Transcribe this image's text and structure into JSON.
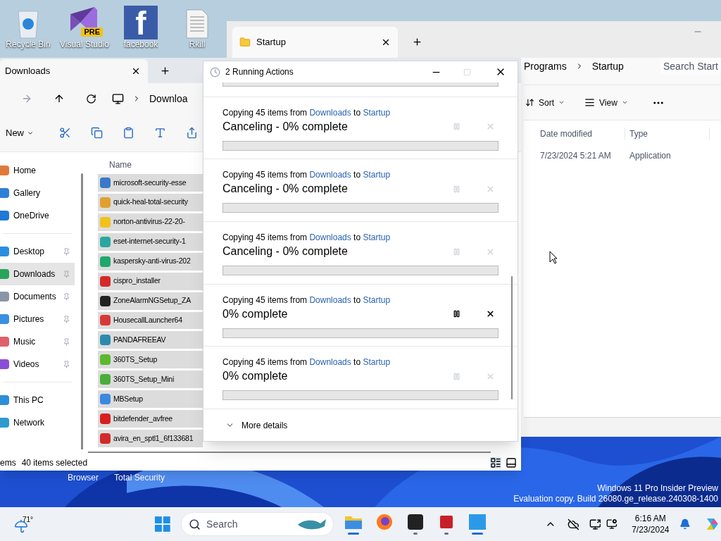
{
  "desktop": {
    "icons": [
      {
        "kind": "bin",
        "label": "Recycle Bin"
      },
      {
        "kind": "vs",
        "label": "Visual Studio",
        "badge": "PRE"
      },
      {
        "kind": "fb",
        "label": "facebook",
        "glyph": "f"
      },
      {
        "kind": "doc",
        "label": "Rkill"
      }
    ],
    "hidden_labels": [
      "Browser",
      "Total Security"
    ],
    "watermark": [
      "Windows 11 Pro Insider Preview",
      "Evaluation copy. Build 26080.ge_release.240308-1400"
    ]
  },
  "startup_window": {
    "tab": "Startup",
    "breadcrumb": [
      "Programs",
      "Startup"
    ],
    "search": {
      "placeholder": "Search Start"
    },
    "toolbar": [
      "Sort",
      "View"
    ],
    "columns": [
      "Date modified",
      "Type"
    ],
    "rows": [
      [
        "7/23/2024 5:21 AM",
        "Application"
      ]
    ]
  },
  "downloads_window": {
    "tab": "Downloads",
    "address": "Downloa",
    "new_button": "New",
    "sidebar_groups": [
      {
        "items": [
          {
            "label": "Home",
            "pinned": false,
            "selected": false,
            "color": "#e07a3a"
          },
          {
            "label": "Gallery",
            "pinned": false,
            "selected": false,
            "color": "#2f7fd8"
          },
          {
            "label": "OneDrive",
            "pinned": false,
            "selected": false,
            "color": "#1e78d6"
          }
        ]
      },
      {
        "items": [
          {
            "label": "Desktop",
            "pinned": true,
            "selected": false,
            "color": "#2c8de0"
          },
          {
            "label": "Downloads",
            "pinned": true,
            "selected": true,
            "color": "#2aa35a"
          },
          {
            "label": "Documents",
            "pinned": true,
            "selected": false,
            "color": "#8a96a6"
          },
          {
            "label": "Pictures",
            "pinned": true,
            "selected": false,
            "color": "#3b8fe0"
          },
          {
            "label": "Music",
            "pinned": true,
            "selected": false,
            "color": "#e0606a"
          },
          {
            "label": "Videos",
            "pinned": true,
            "selected": false,
            "color": "#8a4fd8"
          }
        ]
      },
      {
        "items": [
          {
            "label": "This PC",
            "pinned": false,
            "selected": false,
            "color": "#2f8ed8"
          },
          {
            "label": "Network",
            "pinned": false,
            "selected": false,
            "color": "#2f9ad0"
          }
        ]
      }
    ],
    "name_column": "Name",
    "files": [
      {
        "name": "microsoft-security-esse",
        "selected": true,
        "color": "#3a78c8"
      },
      {
        "name": "quick-heal-total-security",
        "selected": true,
        "color": "#e0a030"
      },
      {
        "name": "norton-antivirus-22-20-",
        "selected": true,
        "color": "#f2c21a"
      },
      {
        "name": "eset-internet-security-1",
        "selected": true,
        "color": "#2aa8a0"
      },
      {
        "name": "kaspersky-anti-virus-202",
        "selected": true,
        "color": "#1fa86a"
      },
      {
        "name": "cispro_installer",
        "selected": true,
        "color": "#d42a2a"
      },
      {
        "name": "ZoneAlarmNGSetup_ZA",
        "selected": true,
        "color": "#222222"
      },
      {
        "name": "HousecallLauncher64",
        "selected": true,
        "color": "#d83838"
      },
      {
        "name": "PANDAFREEAV",
        "selected": true,
        "color": "#2c8ab0"
      },
      {
        "name": "360TS_Setup",
        "selected": true,
        "color": "#5cb82e"
      },
      {
        "name": "360TS_Setup_Mini",
        "selected": true,
        "color": "#4cac3a"
      },
      {
        "name": "MBSetup",
        "selected": true,
        "color": "#3a8ae0"
      },
      {
        "name": "bitdefender_avfree",
        "selected": true,
        "color": "#d62020"
      },
      {
        "name": "avira_en_sptl1_6f133681",
        "selected": true,
        "color": "#d22a2a"
      }
    ],
    "status": [
      "ems",
      "40 items selected"
    ]
  },
  "dialog": {
    "title": "2 Running Actions",
    "operations": [
      {
        "kind": "clipped",
        "level": 0
      },
      {
        "kind": "full",
        "intro": "Copying 45 items from",
        "source": "Downloads",
        "joiner": "to",
        "target": "Startup",
        "status": "Canceling - 0% complete",
        "disabled": true,
        "level": 0
      },
      {
        "kind": "full",
        "intro": "Copying 45 items from",
        "source": "Downloads",
        "joiner": "to",
        "target": "Startup",
        "status": "Canceling - 0% complete",
        "disabled": true,
        "level": 0
      },
      {
        "kind": "full",
        "intro": "Copying 45 items from",
        "source": "Downloads",
        "joiner": "to",
        "target": "Startup",
        "status": "Canceling - 0% complete",
        "disabled": true,
        "level": 0
      },
      {
        "kind": "full",
        "intro": "Copying 45 items from",
        "source": "Downloads",
        "joiner": "to",
        "target": "Startup",
        "status": "0% complete",
        "disabled": false,
        "level": 0
      },
      {
        "kind": "full",
        "intro": "Copying 45 items from",
        "source": "Downloads",
        "joiner": "to",
        "target": "Startup",
        "status": "0% complete",
        "disabled": true,
        "level": 0
      }
    ],
    "more_details": "More details"
  },
  "taskbar": {
    "weather": "71°",
    "search": {
      "placeholder": "Search"
    },
    "apps": [
      {
        "kind": "explorer",
        "active": true
      },
      {
        "kind": "firefox",
        "active": false
      },
      {
        "kind": "zone",
        "active": true
      },
      {
        "kind": "comodo",
        "active": true
      },
      {
        "kind": "blue",
        "active": true
      }
    ],
    "time": "6:16 AM",
    "date": "7/23/2024"
  }
}
